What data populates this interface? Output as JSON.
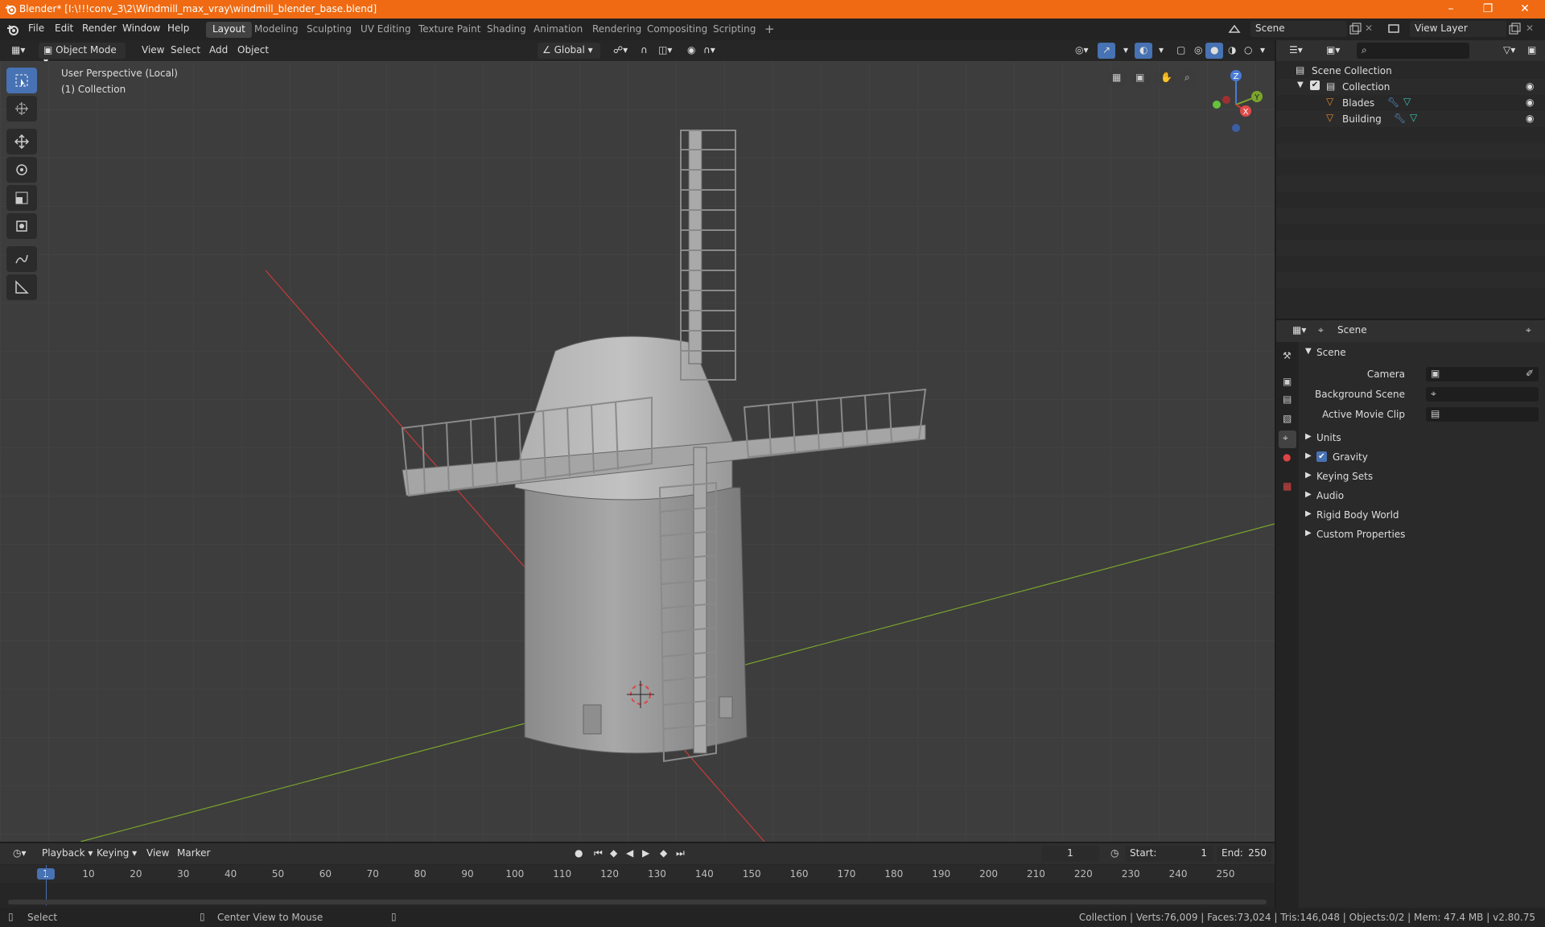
{
  "window": {
    "title": "Blender* [I:\\!!!conv_3\\2\\Windmill_max_vray\\windmill_blender_base.blend]"
  },
  "menu": [
    "File",
    "Edit",
    "Render",
    "Window",
    "Help"
  ],
  "workspaces": [
    "Layout",
    "Modeling",
    "Sculpting",
    "UV Editing",
    "Texture Paint",
    "Shading",
    "Animation",
    "Rendering",
    "Compositing",
    "Scripting"
  ],
  "active_workspace": "Layout",
  "scene_field": "Scene",
  "view_layer_field": "View Layer",
  "viewport_header": {
    "mode": "Object Mode",
    "menus": [
      "View",
      "Select",
      "Add",
      "Object"
    ],
    "orientation": "Global"
  },
  "viewport": {
    "perspective": "User Perspective (Local)",
    "collection": "(1) Collection"
  },
  "gizmo": {
    "z": "Z",
    "y": "Y",
    "x": "X"
  },
  "outliner": {
    "root": "Scene Collection",
    "collection": "Collection",
    "items": [
      "Blades",
      "Building"
    ]
  },
  "properties": {
    "header_title": "Scene",
    "section": "Scene",
    "fields": [
      {
        "label": "Camera"
      },
      {
        "label": "Background Scene"
      },
      {
        "label": "Active Movie Clip"
      }
    ],
    "panels": [
      "Units",
      "Gravity",
      "Keying Sets",
      "Audio",
      "Rigid Body World",
      "Custom Properties"
    ]
  },
  "timeline": {
    "menus": [
      "Playback",
      "Keying",
      "View",
      "Marker"
    ],
    "current_frame": "1",
    "start_label": "Start:",
    "start": "1",
    "end_label": "End:",
    "end": "250",
    "ticks": [
      "1",
      "10",
      "20",
      "30",
      "40",
      "50",
      "60",
      "70",
      "80",
      "90",
      "100",
      "110",
      "120",
      "130",
      "140",
      "150",
      "160",
      "170",
      "180",
      "190",
      "200",
      "210",
      "220",
      "230",
      "240",
      "250"
    ]
  },
  "status": {
    "select": "Select",
    "center": "Center View to Mouse",
    "stats": "Collection | Verts:76,009 | Faces:73,024 | Tris:146,048 | Objects:0/2 | Mem: 47.4 MB | v2.80.75"
  },
  "colors": {
    "accent": "#4772b3",
    "titlebar": "#ef6a12",
    "object_orange": "#e8882a",
    "x_axis": "#c83a3a",
    "y_axis": "#7ba52c"
  }
}
